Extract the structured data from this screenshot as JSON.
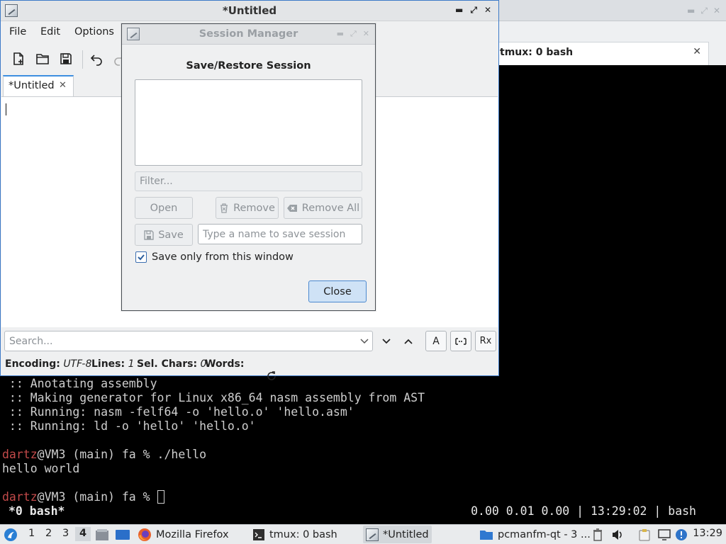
{
  "terminal": {
    "tab_label": "tmux: 0 bash",
    "close_glyph": "✕",
    "lines": [
      " :: Anotating assembly",
      " :: Making generator for Linux x86_64 nasm assembly from AST",
      " :: Running: nasm -felf64 -o 'hello.o' 'hello.asm'",
      " :: Running: ld -o 'hello' 'hello.o'",
      ""
    ],
    "prompt1_user": "dartz",
    "prompt1_rest": "@VM3 (main) fa % ./hello",
    "output": "hello world",
    "prompt2_user": "dartz",
    "prompt2_rest": "@VM3 (main) fa % ",
    "status_left": "*0 bash*",
    "status_right": "0.00 0.01 0.00 | 13:29:02 | bash"
  },
  "editor": {
    "title": "*Untitled",
    "menu": [
      "File",
      "Edit",
      "Options"
    ],
    "doc_tab_label": "*Untitled",
    "doc_tab_close": "✕",
    "search_placeholder": "Search...",
    "case_glyph": "A",
    "regex_glyph": "Rx",
    "status": {
      "encoding_label": "Encoding:",
      "encoding_value": "UTF-8",
      "lines_label": "Lines:",
      "lines_value": "1",
      "selchars_label": "Sel. Chars:",
      "selchars_value": "0",
      "words_label": "Words:"
    }
  },
  "session_dialog": {
    "title": "Session Manager",
    "heading": "Save/Restore Session",
    "filter_placeholder": "Filter...",
    "open_label": "Open",
    "remove_label": "Remove",
    "remove_all_label": "Remove All",
    "save_label": "Save",
    "name_placeholder": "Type a name to save session",
    "checkbox_label": "Save only from this window",
    "checkbox_checked": true,
    "close_label": "Close"
  },
  "taskbar": {
    "workspaces": [
      "1",
      "2",
      "3",
      "4"
    ],
    "active_workspace": "4",
    "tasks": [
      {
        "label": "Mozilla Firefox",
        "icon": "firefox-icon"
      },
      {
        "label": "tmux: 0 bash",
        "icon": "terminal-icon"
      },
      {
        "label": "*Untitled",
        "icon": "text-editor-icon"
      },
      {
        "label": "pcmanfm-qt - 3 ...",
        "icon": "folder-icon"
      }
    ],
    "clock": "13:29"
  },
  "colors": {
    "accent": "#3d7ac8",
    "prompt_user": "#c34a4a",
    "terminal_bg": "#000000"
  }
}
